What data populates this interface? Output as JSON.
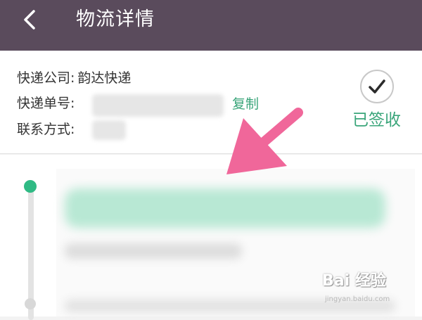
{
  "header": {
    "title": "物流详情"
  },
  "info": {
    "company_label": "快递公司:",
    "company_value": "韵达快递",
    "tracking_label": "快递单号:",
    "contact_label": "联系方式:",
    "copy_label": "复制",
    "status_label": "已签收"
  },
  "watermark": {
    "main": "Bai 经验",
    "sub": "jingyan.baidu.com"
  },
  "colors": {
    "header_bg": "#5a4b5c",
    "accent_green": "#3aa57a",
    "timeline_active": "#2fba84",
    "annotation_arrow": "#f0679a"
  },
  "icons": {
    "back": "back-chevron-icon",
    "status": "check-circle-icon",
    "annotation": "pink-arrow-icon"
  }
}
